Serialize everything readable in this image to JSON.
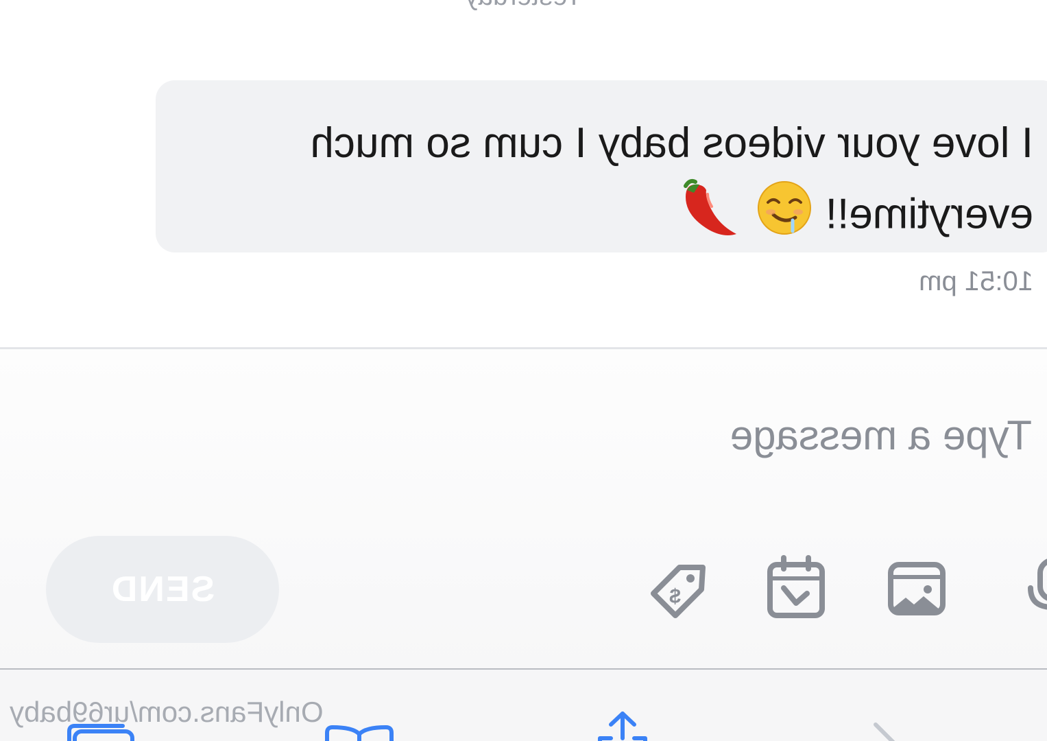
{
  "chat": {
    "day_label": "Yesterday",
    "messages": [
      {
        "text": "I love your videos baby I cum so much everytime!!",
        "time": "10:51 pm"
      }
    ]
  },
  "composer": {
    "placeholder": "Type a message",
    "send_label": "SEND",
    "tools": [
      "mic-icon",
      "image-icon",
      "calendar-icon",
      "price-tag-icon"
    ]
  },
  "browser_bar": {
    "url": "OnlyFans.com/ur69baby",
    "icons": [
      "back-icon",
      "share-icon",
      "bookmarks-icon",
      "tabs-icon"
    ]
  },
  "colors": {
    "bubble_bg": "#f1f2f4",
    "icon_gray": "#8a8e96",
    "nav_blue": "#3b82f6",
    "send_bg": "#eceef1"
  }
}
